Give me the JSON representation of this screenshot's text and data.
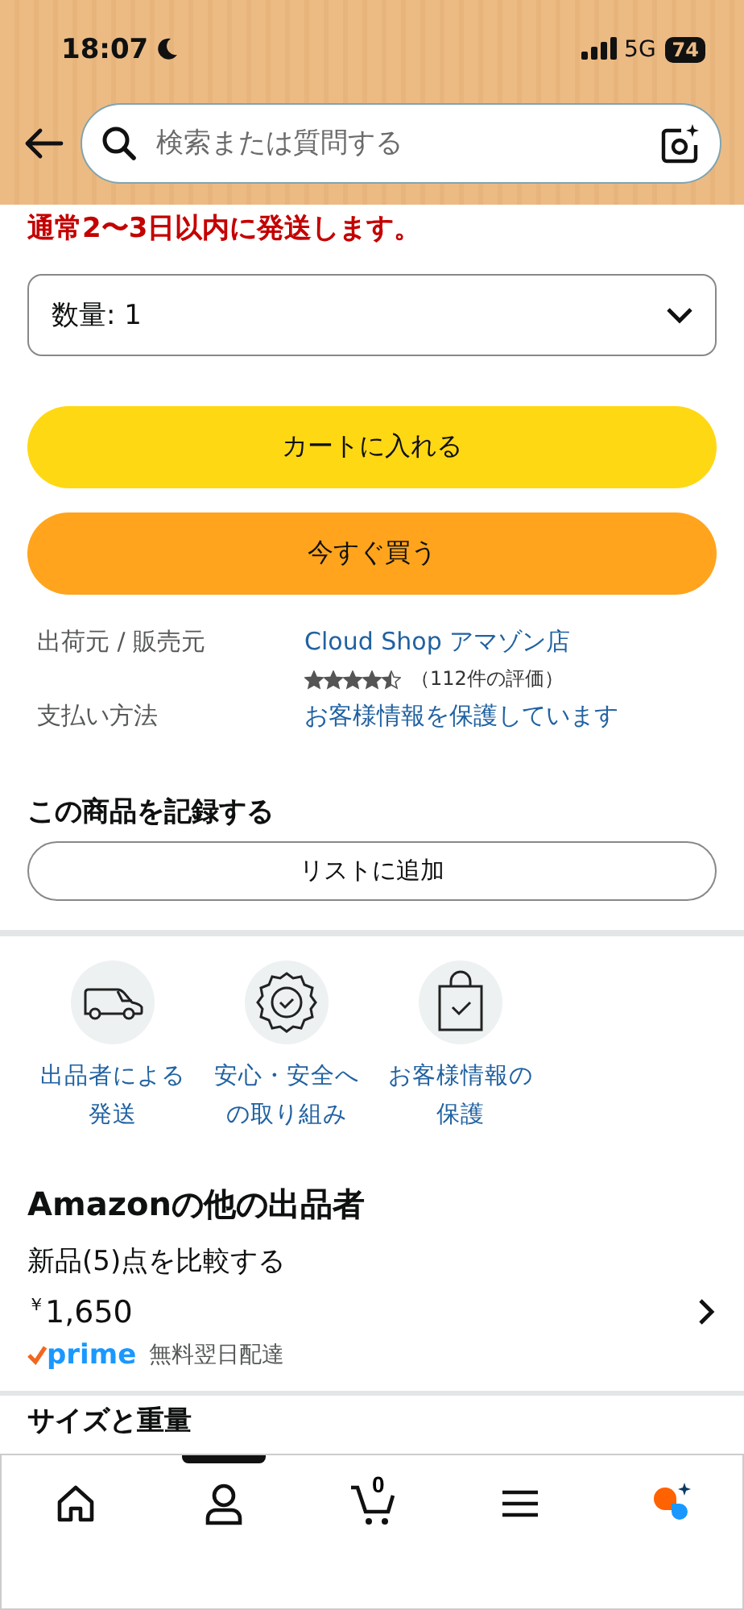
{
  "status_bar": {
    "time": "18:07",
    "network": "5G",
    "battery": "74"
  },
  "search": {
    "placeholder": "検索または質問する"
  },
  "shipping_notice": "通常2〜3日以内に発送します。",
  "quantity": {
    "label": "数量: 1"
  },
  "buttons": [
    {
      "kind": "cart",
      "label": "カートに入れる"
    },
    {
      "kind": "buy",
      "label": "今すぐ買う"
    }
  ],
  "seller_info": [
    {
      "label": "出荷元 / 販売元",
      "value": "Cloud Shop アマゾン店",
      "stars": 4.5,
      "rating_count": "（112件の評価）"
    },
    {
      "label": "支払い方法",
      "value": "お客様情報を保護しています"
    }
  ],
  "record": {
    "heading": "この商品を記録する",
    "button": "リストに追加"
  },
  "features": [
    {
      "kind": "van",
      "label_lines": [
        "出品者による",
        "発送"
      ]
    },
    {
      "kind": "badge",
      "label_lines": [
        "安心・安全へ",
        "の取り組み"
      ]
    },
    {
      "kind": "bag",
      "label_lines": [
        "お客様情報の",
        "保護"
      ]
    }
  ],
  "other_sellers": {
    "heading": "Amazonの他の出品者",
    "compare": "新品(5)点を比較する",
    "price_symbol": "￥",
    "price": "1,650",
    "prime": "prime",
    "delivery": "無料翌日配達"
  },
  "next_section": "サイズと重量",
  "nav": [
    {
      "kind": "home",
      "selected": false
    },
    {
      "kind": "account",
      "selected": true
    },
    {
      "kind": "cart",
      "selected": false,
      "count": "0"
    },
    {
      "kind": "menu",
      "selected": false
    },
    {
      "kind": "assistant",
      "selected": false
    }
  ]
}
